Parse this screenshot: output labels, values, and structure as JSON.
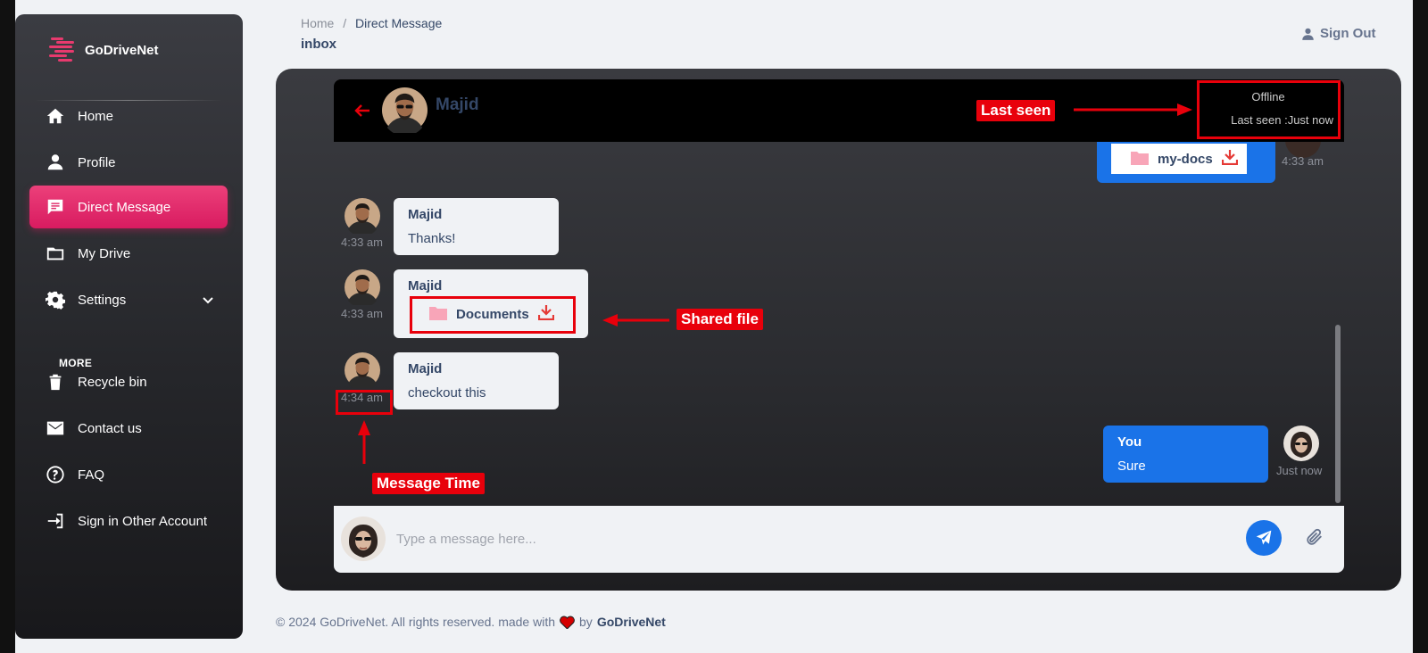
{
  "brand": {
    "name": "GoDriveNet"
  },
  "sidebar": {
    "items": [
      {
        "label": "Home",
        "icon": "home-icon"
      },
      {
        "label": "Profile",
        "icon": "user-icon"
      },
      {
        "label": "Direct Message",
        "icon": "chat-icon",
        "active": true
      },
      {
        "label": "My Drive",
        "icon": "folder-icon"
      },
      {
        "label": "Settings",
        "icon": "gear-icon"
      }
    ],
    "more_label": "MORE",
    "more_items": [
      {
        "label": "Recycle bin",
        "icon": "trash-icon"
      },
      {
        "label": "Contact us",
        "icon": "mail-icon"
      },
      {
        "label": "FAQ",
        "icon": "question-icon"
      },
      {
        "label": "Sign in Other Account",
        "icon": "sign-in-icon"
      }
    ]
  },
  "header": {
    "breadcrumb": {
      "home": "Home",
      "sep": "/",
      "current": "Direct Message"
    },
    "title": "inbox",
    "signout_label": "Sign Out"
  },
  "chat": {
    "contact_name": "Majid",
    "status": "Offline",
    "last_seen": "Last seen :Just now",
    "messages": [
      {
        "sender": "me",
        "file": "my-docs",
        "time": "4:33 am"
      },
      {
        "sender": "Majid",
        "text": "Thanks!",
        "time": "4:33 am"
      },
      {
        "sender": "Majid",
        "file": "Documents",
        "time": "4:33 am"
      },
      {
        "sender": "Majid",
        "text": "checkout this",
        "time": "4:34 am"
      },
      {
        "sender": "You",
        "text": "Sure",
        "time": "Just now"
      }
    ],
    "composer_placeholder": "Type a message here..."
  },
  "annotations": {
    "last_seen": "Last seen",
    "shared_file": "Shared file",
    "message_time": "Message Time"
  },
  "footer": {
    "text": "© 2024 GoDriveNet. All rights reserved. made with",
    "by": "by",
    "brand": "GoDriveNet"
  },
  "colors": {
    "accent_pink": "#e91e63",
    "accent_blue": "#1a73e8",
    "annotation_red": "#e8000b",
    "text_dark": "#344767"
  }
}
